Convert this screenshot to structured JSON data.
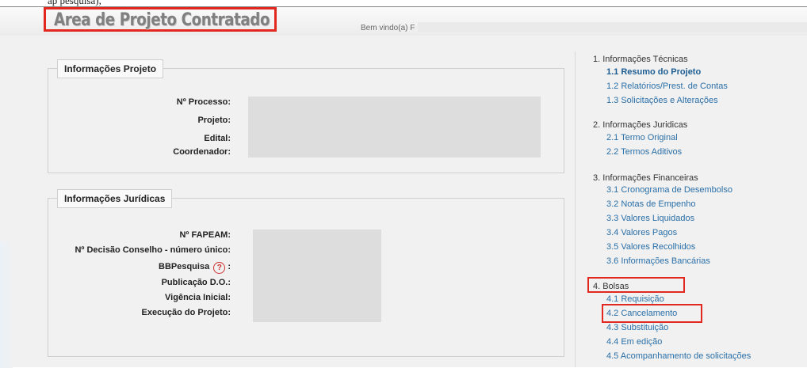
{
  "header": {
    "title": "Area de Projeto Contratado",
    "welcome": "Bem vindo(a) F",
    "cut_text": "ap                  pesquisa),"
  },
  "project_info": {
    "legend": "Informações Projeto",
    "labels": {
      "processo": "Nº Processo:",
      "projeto": "Projeto:",
      "edital": "Edital:",
      "coordenador": "Coordenador:"
    }
  },
  "legal_info": {
    "legend": "Informações Jurídicas",
    "labels": {
      "fapeam": "Nº FAPEAM:",
      "decisao": "Nº Decisão Conselho - número único:",
      "bbpesquisa": "BBPesquisa",
      "bbpesquisa_colon": ":",
      "publicacao": "Publicação D.O.:",
      "vigencia": "Vigência Inicial:",
      "execucao": "Execução do Projeto:"
    },
    "help_icon": "?"
  },
  "sidebar": {
    "sections": [
      {
        "title": "1. Informações Técnicas",
        "items": [
          "1.1 Resumo do Projeto",
          "1.2 Relatórios/Prest. de Contas",
          "1.3 Solicitações e Alterações"
        ]
      },
      {
        "title": "2. Informações Juridicas",
        "items": [
          "2.1 Termo Original",
          "2.2 Termos Aditivos"
        ]
      },
      {
        "title": "3. Informações Financeiras",
        "items": [
          "3.1 Cronograma de Desembolso",
          "3.2 Notas de Empenho",
          "3.3 Valores Liquidados",
          "3.4 Valores Pagos",
          "3.5 Valores Recolhidos",
          "3.6 Informações Bancárias"
        ]
      },
      {
        "title": "4. Bolsas",
        "items": [
          "4.1 Requisição",
          "4.2 Cancelamento",
          "4.3 Substituição",
          "4.4 Em edição",
          "4.5 Acompanhamento de solicitações"
        ]
      }
    ],
    "active_item": "1.1 Resumo do Projeto"
  },
  "colors": {
    "highlight": "#e0281f",
    "link": "#2a6fa8",
    "background": "#f1f1f1"
  }
}
